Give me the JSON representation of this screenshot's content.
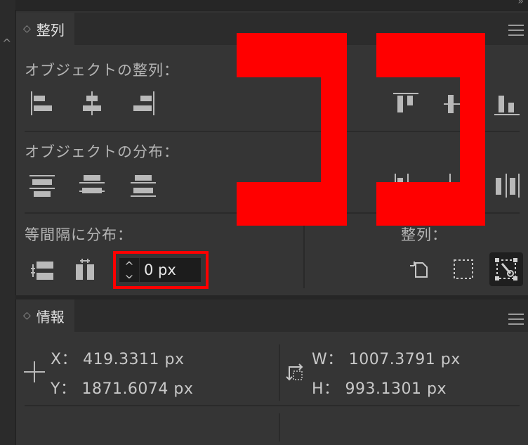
{
  "top_bar": {
    "collapse_glyph": "»"
  },
  "left_strip": {
    "chevron": "^"
  },
  "align_panel": {
    "tab_label": "整列",
    "align_objects_label": "オブジェクトの整列：",
    "distribute_objects_label": "オブジェクトの分布：",
    "distribute_spacing_label": "等間隔に分布：",
    "align_to_label": "整列：",
    "spacing_value": "0 px",
    "icons": [
      "align-left-icon",
      "align-horizontal-center-icon",
      "align-right-icon",
      "align-top-icon",
      "align-vertical-center-icon",
      "align-bottom-icon",
      "distribute-top-icon",
      "distribute-vertical-center-icon",
      "distribute-bottom-icon",
      "distribute-left-icon",
      "distribute-horizontal-center-icon",
      "distribute-right-icon",
      "vertical-distribute-space-icon",
      "horizontal-distribute-space-icon",
      "align-to-artboard-icon",
      "align-to-selection-icon",
      "align-to-key-object-icon"
    ]
  },
  "info_panel": {
    "tab_label": "情報",
    "x_label": "X：",
    "x_value": "419.3311 px",
    "y_label": "Y：",
    "y_value": "1871.6074 px",
    "w_label": "W：",
    "w_value": "1007.3791 px",
    "h_label": "H：",
    "h_value": "993.1301 px"
  },
  "colors": {
    "highlight": "#ff0000",
    "panel_bg": "#353535",
    "tab_bar_bg": "#2c2c2c",
    "field_bg": "#1c1c1c"
  }
}
